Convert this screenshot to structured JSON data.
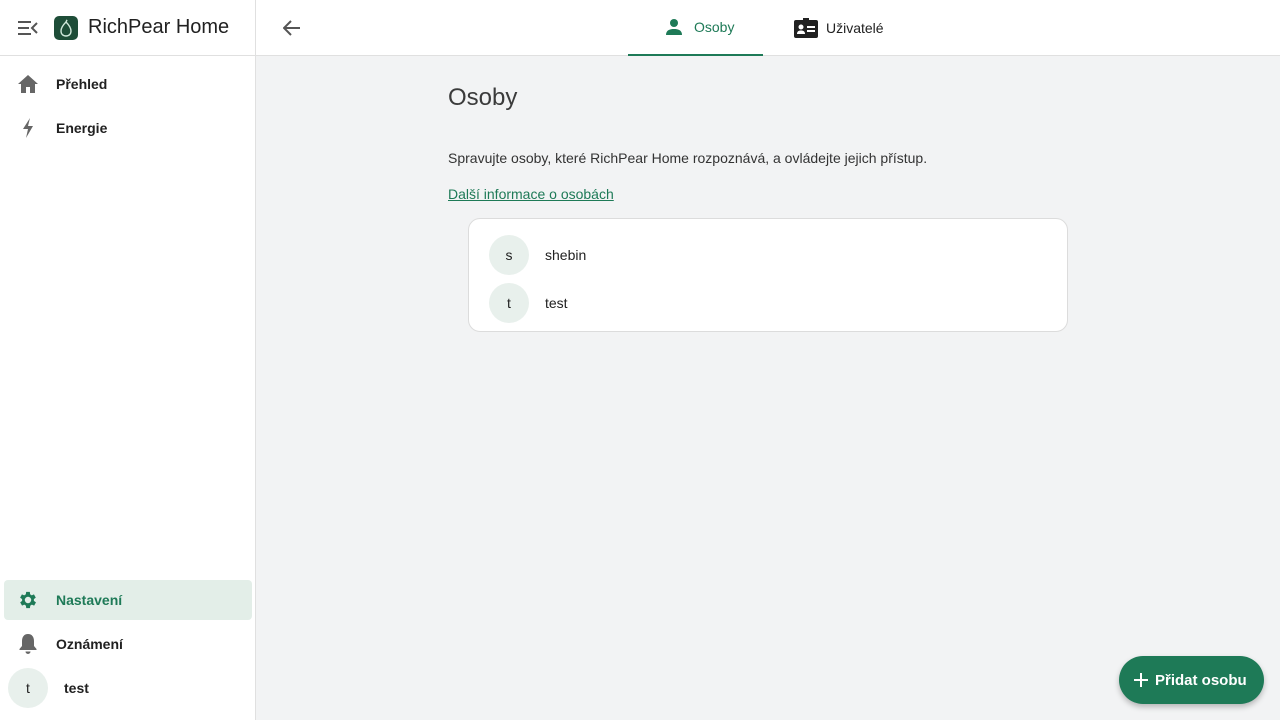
{
  "sidebar": {
    "app_title": "RichPear Home",
    "items": [
      {
        "label": "Přehled",
        "icon": "home-icon"
      },
      {
        "label": "Energie",
        "icon": "lightning-icon"
      },
      {
        "label": "Nastavení",
        "icon": "gear-icon"
      },
      {
        "label": "Oznámení",
        "icon": "bell-icon"
      }
    ],
    "user": {
      "initial": "t",
      "name": "test"
    }
  },
  "topbar": {
    "tabs": [
      {
        "label": "Osoby",
        "icon": "person-icon"
      },
      {
        "label": "Uživatelé",
        "icon": "id-card-icon"
      }
    ]
  },
  "main": {
    "title": "Osoby",
    "description": "Spravujte osoby, které RichPear Home rozpoznává, a ovládejte jejich přístup.",
    "more_link": "Další informace o osobách",
    "persons": [
      {
        "initial": "s",
        "name": "shebin"
      },
      {
        "initial": "t",
        "name": "test"
      }
    ],
    "fab_label": "Přidat osobu"
  },
  "colors": {
    "accent": "#1e7a57",
    "active_bg": "#e3eee8",
    "page_bg": "#f2f3f4"
  }
}
